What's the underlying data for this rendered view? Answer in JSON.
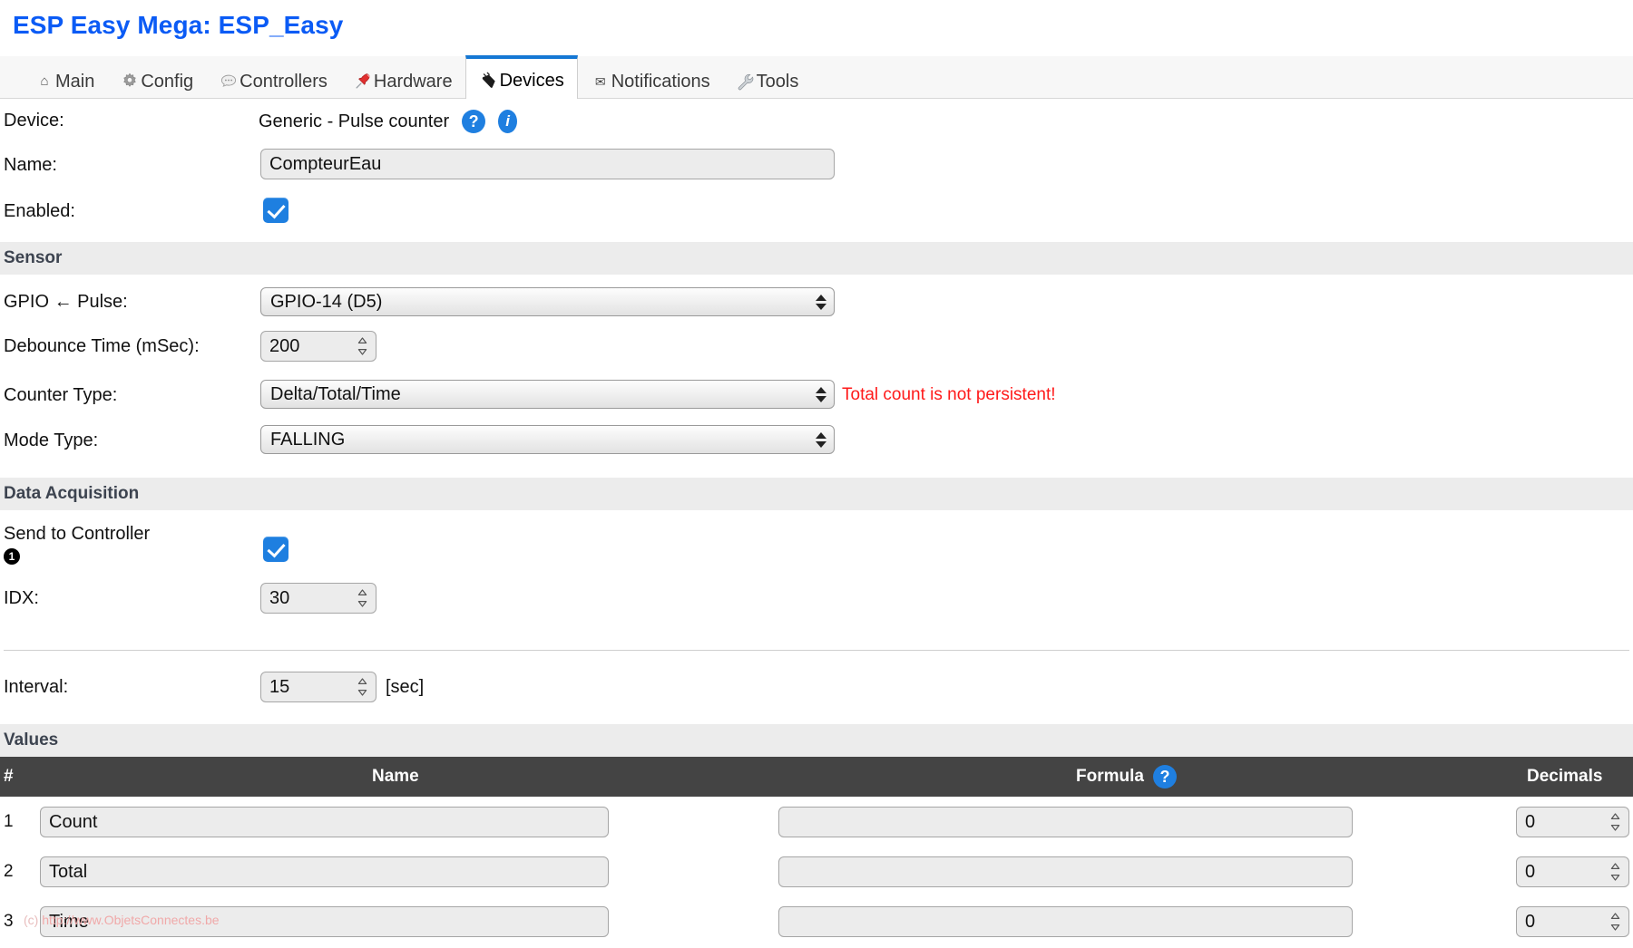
{
  "header": {
    "title": "ESP Easy Mega: ESP_Easy",
    "title_color": "#0b5bf5"
  },
  "tabs": [
    {
      "label": "Main",
      "icon": "home-icon",
      "active": false
    },
    {
      "label": "Config",
      "icon": "gear-icon",
      "active": false
    },
    {
      "label": "Controllers",
      "icon": "bubble-icon",
      "active": false
    },
    {
      "label": "Hardware",
      "icon": "pushpin-icon",
      "active": false
    },
    {
      "label": "Devices",
      "icon": "plug-icon",
      "active": true
    },
    {
      "label": "Notifications",
      "icon": "mail-icon",
      "active": false
    },
    {
      "label": "Tools",
      "icon": "wrench-icon",
      "active": false
    }
  ],
  "device": {
    "label": "Device:",
    "value": "Generic - Pulse counter",
    "help_badge": "?",
    "info_badge": "i"
  },
  "name": {
    "label": "Name:",
    "value": "CompteurEau",
    "placeholder": ""
  },
  "enabled": {
    "label": "Enabled:",
    "checked": true
  },
  "sensor": {
    "section_title": "Sensor",
    "gpio": {
      "label": "GPIO ← Pulse:",
      "value": "GPIO-14 (D5)",
      "options": [
        "GPIO-14 (D5)"
      ]
    },
    "debounce": {
      "label": "Debounce Time (mSec):",
      "value": "200"
    },
    "counter_type": {
      "label": "Counter Type:",
      "value": "Delta/Total/Time",
      "options": [
        "Delta/Total/Time"
      ],
      "warning": "Total count is not persistent!",
      "warning_color": "#ff1a1a"
    },
    "mode_type": {
      "label": "Mode Type:",
      "value": "FALLING",
      "options": [
        "FALLING"
      ]
    }
  },
  "data_acquisition": {
    "section_title": "Data Acquisition",
    "send_to_controller": {
      "label": "Send to Controller",
      "controller_number": "1",
      "checked": true
    },
    "idx": {
      "label": "IDX:",
      "value": "30"
    }
  },
  "interval": {
    "label": "Interval:",
    "value": "15",
    "unit": "[sec]"
  },
  "values": {
    "section_title": "Values",
    "columns": {
      "index": "#",
      "name": "Name",
      "formula": "Formula",
      "formula_help": "?",
      "decimals": "Decimals"
    },
    "rows": [
      {
        "index": "1",
        "name": "Count",
        "formula": "",
        "decimals": "0"
      },
      {
        "index": "2",
        "name": "Total",
        "formula": "",
        "decimals": "0"
      },
      {
        "index": "3",
        "name": "Time",
        "formula": "",
        "decimals": "0"
      }
    ]
  },
  "watermark": {
    "prefix": "(c) ",
    "url": "http://www.ObjetsConnectes.be"
  }
}
